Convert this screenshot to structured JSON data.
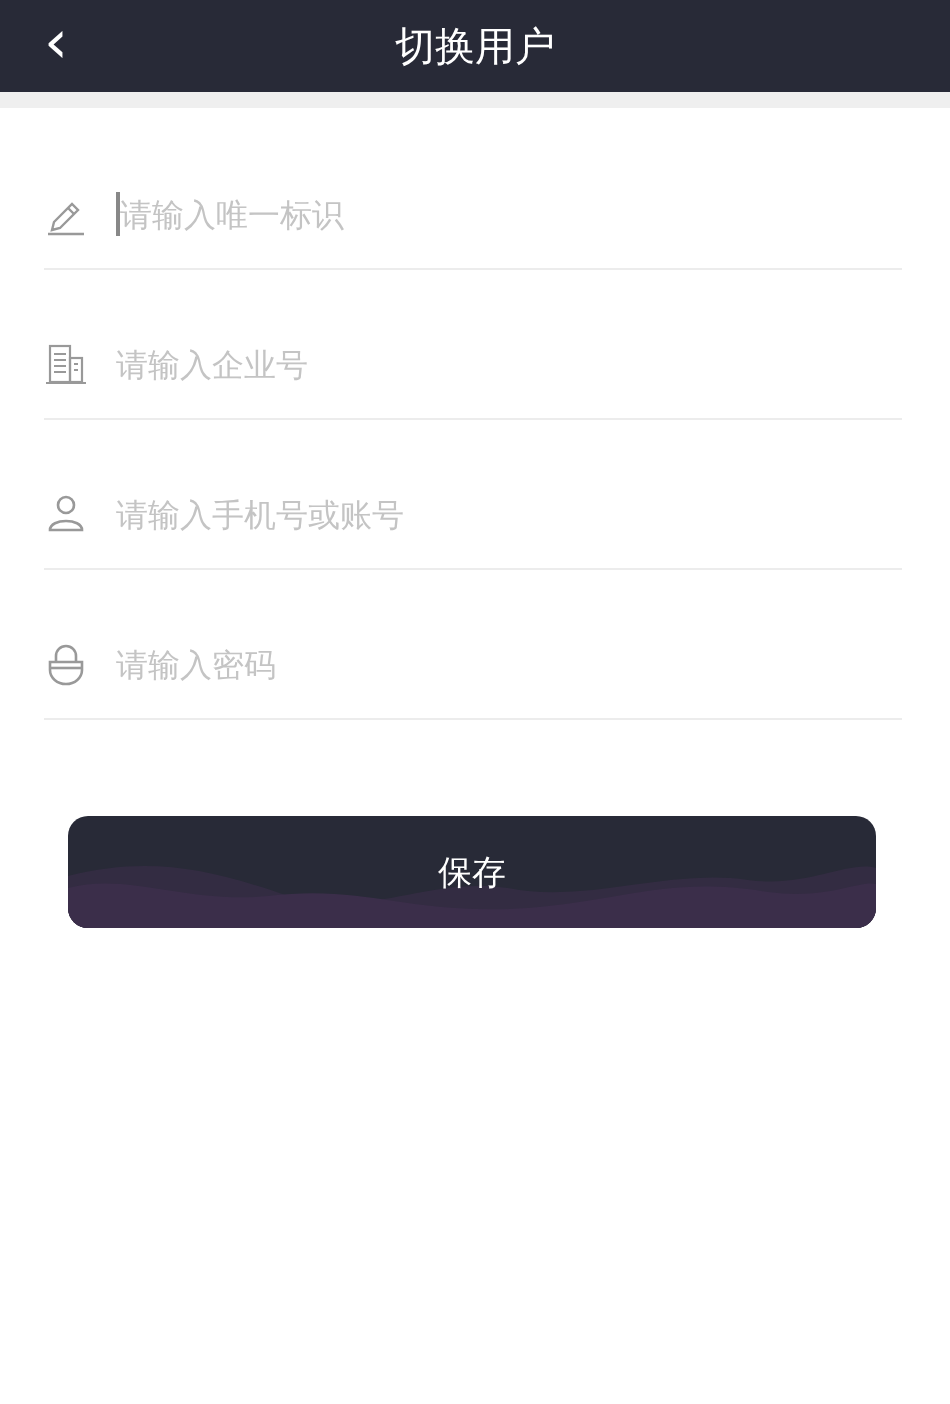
{
  "header": {
    "back_icon": "‹",
    "title": "切换用户"
  },
  "fields": [
    {
      "kind": "pencil",
      "placeholder": "请输入唯一标识",
      "focused": true
    },
    {
      "kind": "building",
      "placeholder": "请输入企业号",
      "focused": false
    },
    {
      "kind": "person",
      "placeholder": "请输入手机号或账号",
      "focused": false
    },
    {
      "kind": "lock",
      "placeholder": "请输入密码",
      "focused": false
    }
  ],
  "save_button": {
    "label": "保存"
  }
}
